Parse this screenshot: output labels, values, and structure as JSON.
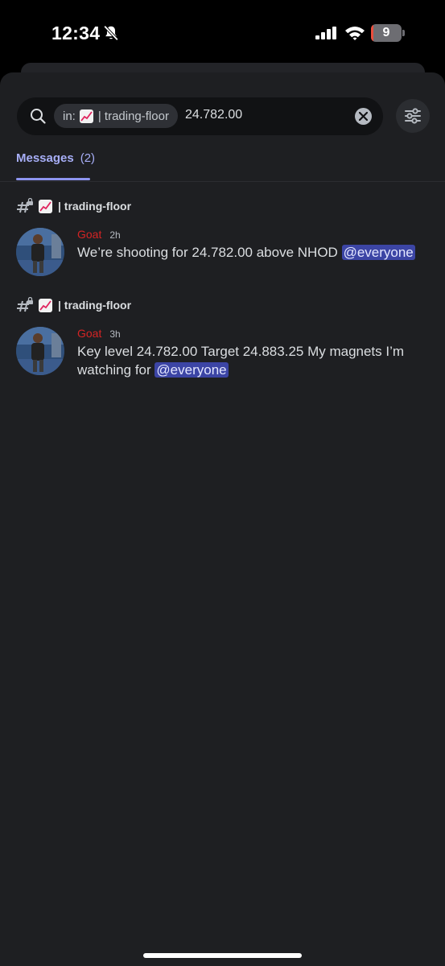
{
  "status_bar": {
    "time": "12:34",
    "battery_level": "9",
    "icons": [
      "bell-off-icon",
      "cellular-signal-icon",
      "wifi-icon",
      "battery-icon"
    ]
  },
  "search": {
    "channel_filter": {
      "prefix": "in:",
      "emoji": "chart-increasing-emoji",
      "channel": "| trading-floor"
    },
    "query": "24.782.00",
    "icons": [
      "search-icon",
      "clear-icon",
      "filter-sliders-icon"
    ]
  },
  "tabs": {
    "messages_label": "Messages",
    "messages_count": "(2)"
  },
  "results": [
    {
      "channel": "| trading-floor",
      "author": "Goat",
      "timestamp": "2h",
      "text": "We’re shooting for 24.782.00 above NHOD",
      "mention": "@everyone"
    },
    {
      "channel": "| trading-floor",
      "author": "Goat",
      "timestamp": "3h",
      "text_line1": "Key level 24.782.00 Target 24.883.25   My magnets I’m",
      "text_line2": "watching for",
      "mention": "@everyone"
    }
  ],
  "colors": {
    "background": "#1e1f22",
    "accent": "#a7aef7",
    "author_name": "#d52424",
    "mention_bg": "#3c45a5",
    "battery_low": "#eb4e3d"
  }
}
